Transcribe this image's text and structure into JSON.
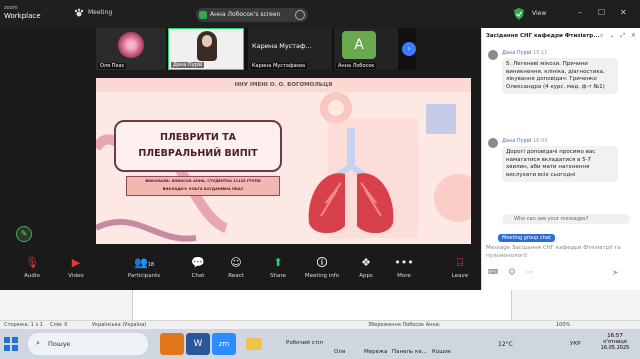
{
  "zoom": {
    "brand_line1": "zoom",
    "brand_line2": "Workplace",
    "meeting_label": "Meeting",
    "share_label": "Анна Лобосок's screen",
    "view_label": "View",
    "participants": [
      {
        "name": "Оля Пкас"
      },
      {
        "name": "Дана Пурій"
      },
      {
        "name": "Карина Мустафаєва",
        "display": "Карина   Мустаф..."
      },
      {
        "name": "Анна Лобосок",
        "initial": "A"
      }
    ],
    "toolbar": {
      "audio": "Audio",
      "video": "Video",
      "participants": "Participants",
      "participants_count": "18",
      "chat": "Chat",
      "react": "React",
      "share": "Share",
      "meeting_info": "Meeting info",
      "apps": "Apps",
      "more": "More",
      "leave": "Leave"
    }
  },
  "slide": {
    "header": "ННУ ІМЕНІ О. О. БОГОМОЛЬЦЯ",
    "title_line1": "ПЛЕВРИТИ ТА",
    "title_line2": "ПЛЕВРАЛЬНИЙ ВИПІТ",
    "authors_line1": "ВИКОНАЛА: ЛОБОСОК АННА, СТУДЕНТКА 11125 ГРУПИ",
    "authors_line2": "ВИКЛАДАЧ: ОЛЬГА БОГДАНІВНА ПКАС"
  },
  "chat": {
    "title": "Засідання СНГ кафедри Фтизіатр...",
    "messages": [
      {
        "sender": "Дана Пурій",
        "time": "15:11",
        "text": "5. Легеневі мікози. Причини виникнення, клініка, діагностика, лікування доповідач: Гриченко Олександра (4 курс, мед. ф-т №1)"
      },
      {
        "sender": "Дана Пурій",
        "time": "16:03",
        "text": "Дорогі доповідачі просимо вас намагатися вкладатися в 5-7 хвилин, аби мати натхнення вислухати всіх сьогодні"
      }
    ],
    "who_can_see": "Who can see your messages?",
    "recipient": "Meeting group chat",
    "input_placeholder": "Message Засідання СНГ кафедри Фтизіатрії та пульмонології"
  },
  "word": {
    "status_page": "Сторінка: 1 з 1",
    "status_words": "Слів: 0",
    "status_lang": "Українська (Україна)",
    "status_saving": "Збереження Лобосок Анна:",
    "zoom_level": "100%"
  },
  "taskbar": {
    "search": "Пошук",
    "desktop": "Робочий стіл",
    "app_user": "Оля",
    "network": "Мережа",
    "control_panel": "Панель ке...",
    "recycle": "Кошик",
    "temperature": "12°C",
    "lang": "УКР",
    "time": "16:57",
    "day": "п'ятниця",
    "date": "16.05.2025"
  }
}
